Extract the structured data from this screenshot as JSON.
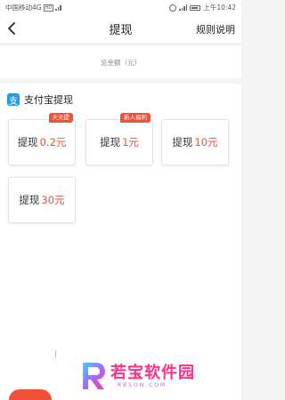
{
  "status_bar": {
    "carrier": "中国移动4G",
    "hd_badge": "HD",
    "time": "上午10:42"
  },
  "nav": {
    "title": "提现",
    "rules_link": "规则说明"
  },
  "total": {
    "label": "总金额（元）"
  },
  "alipay": {
    "title": "支付宝提现",
    "icon_glyph": "支",
    "options": [
      {
        "label": "提现",
        "amount": "0.2元",
        "badge": "天天提"
      },
      {
        "label": "提现",
        "amount": "1元",
        "badge": "新人福利"
      },
      {
        "label": "提现",
        "amount": "10元"
      },
      {
        "label": "提现",
        "amount": "30元"
      }
    ]
  },
  "watermark": {
    "title": "若宝软件园",
    "url": "RBSON.COM"
  },
  "colors": {
    "accent": "#ef5138",
    "amount": "#ef4f36",
    "alipay_blue": "#1a9bef",
    "watermark_pink": "#ff2e86"
  }
}
